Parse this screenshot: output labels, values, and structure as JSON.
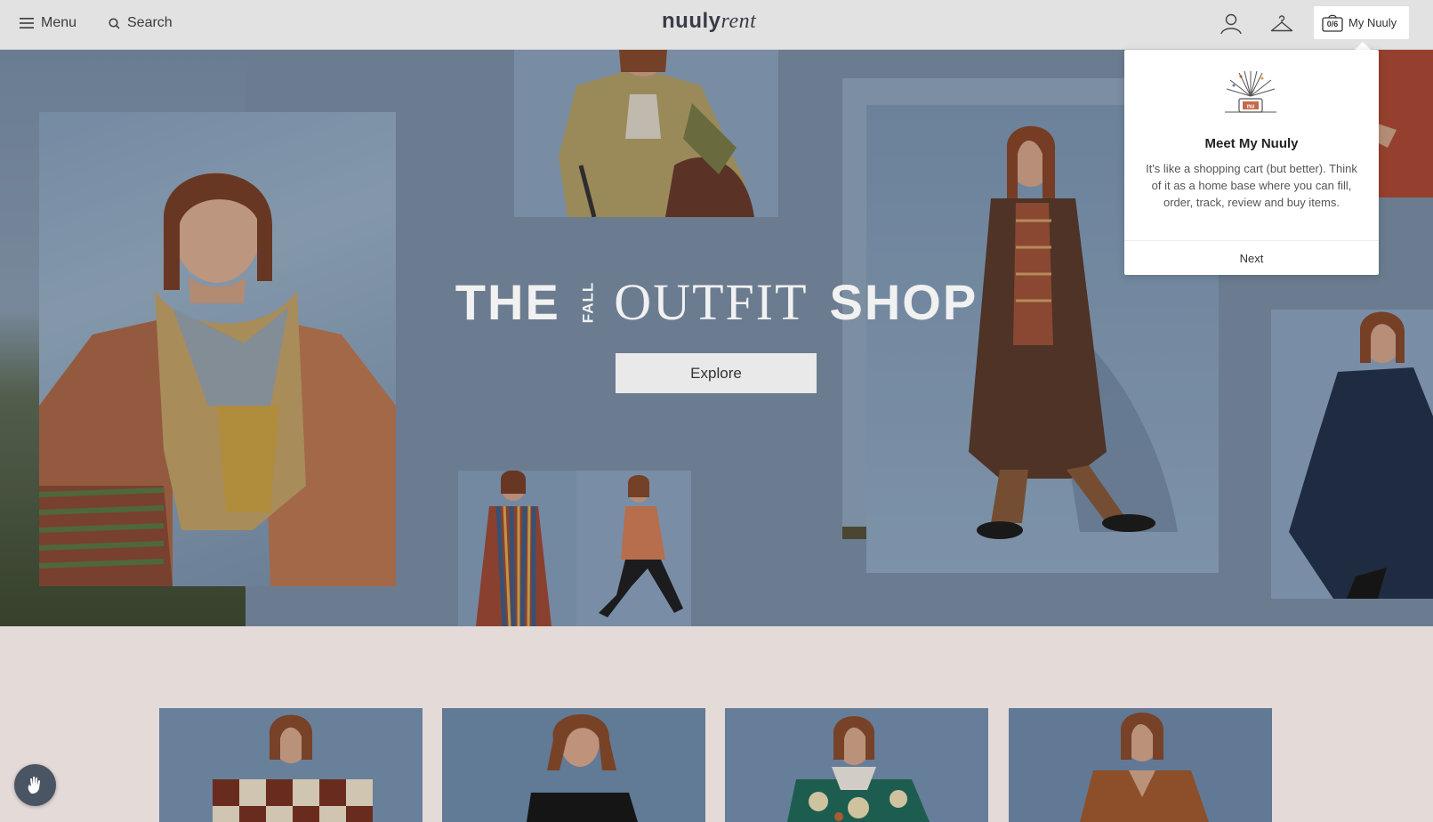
{
  "header": {
    "menu_label": "Menu",
    "search_label": "Search",
    "logo_bold": "nuuly",
    "logo_italic": "rent",
    "my_nuuly_label": "My Nuuly",
    "bag_count": "0/6"
  },
  "hero": {
    "headline_the": "THE",
    "headline_fall": "FALL",
    "headline_outfit": "OUTFIT",
    "headline_shop": "SHOP",
    "explore_label": "Explore"
  },
  "popover": {
    "badge_text": "nu",
    "title": "Meet My Nuuly",
    "text": "It's like a shopping cart (but better). Think of it as a home base where you can fill, order, track, review and buy items.",
    "next_label": "Next"
  },
  "icons": {
    "menu": "hamburger-icon",
    "search": "search-icon",
    "account": "user-icon",
    "closet": "hanger-icon",
    "bag": "bag-icon",
    "help": "hand-wave-icon"
  },
  "colors": {
    "header_bg": "#e2e2e2",
    "hero_bg": "#7e93ab",
    "page_bg": "#e4dad8",
    "logo": "#3b3b48"
  }
}
